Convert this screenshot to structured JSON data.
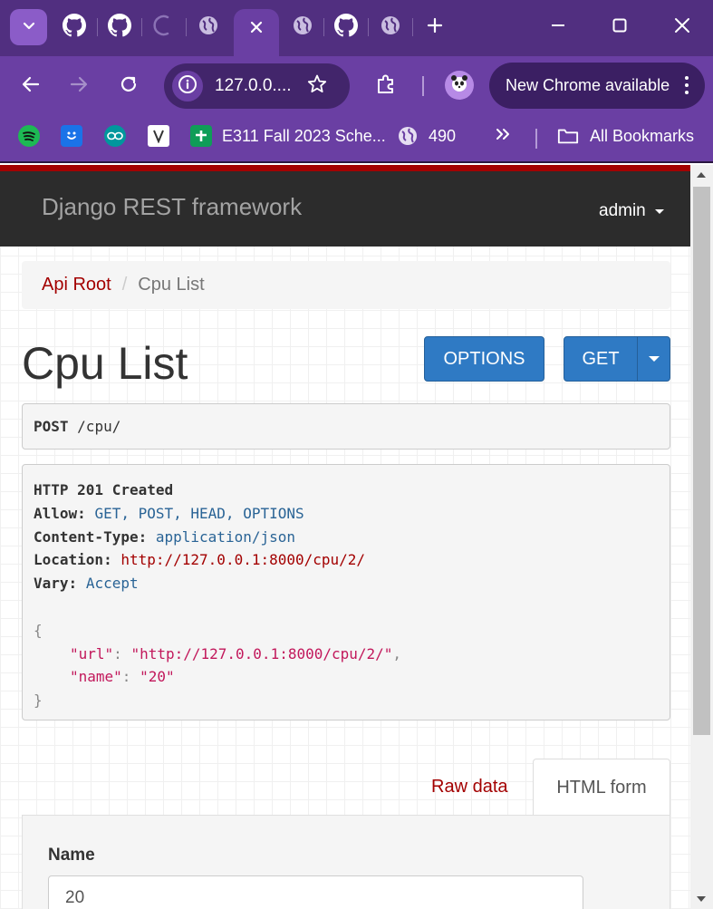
{
  "browser": {
    "tabs": [
      {
        "icon": "github-icon"
      },
      {
        "icon": "github-icon"
      },
      {
        "icon": "loading-spinner-icon"
      },
      {
        "icon": "globe-icon"
      },
      {
        "icon": "close-icon",
        "active": true
      },
      {
        "icon": "globe-icon"
      },
      {
        "icon": "github-icon"
      },
      {
        "icon": "globe-icon"
      }
    ],
    "new_tab_icon": "plus-icon",
    "address": {
      "url_display": "127.0.0...."
    },
    "update_button": "New Chrome available",
    "bookmarks": [
      {
        "icon": "spotify-icon",
        "label": ""
      },
      {
        "icon": "bookmark-app-icon",
        "label": ""
      },
      {
        "icon": "arduino-icon",
        "label": ""
      },
      {
        "icon": "v-logo-icon",
        "label": ""
      },
      {
        "icon": "sheets-icon",
        "label": "E311 Fall 2023 Sche..."
      },
      {
        "icon": "globe-icon",
        "label": "490"
      }
    ],
    "all_bookmarks": "All Bookmarks"
  },
  "colors": {
    "brand_red": "#a30000",
    "button_blue": "#2f7ac4",
    "chrome_purple": "#6a3fa3"
  },
  "navbar": {
    "brand": "Django REST framework",
    "user": "admin"
  },
  "breadcrumb": {
    "root": "Api Root",
    "separator": "/",
    "current": "Cpu List"
  },
  "page": {
    "title": "Cpu List",
    "options_button": "OPTIONS",
    "get_button": "GET"
  },
  "request": {
    "method": "POST",
    "path": "/cpu/"
  },
  "response": {
    "status": "HTTP 201 Created",
    "headers": [
      {
        "key": "Allow:",
        "value": "GET, POST, HEAD, OPTIONS"
      },
      {
        "key": "Content-Type:",
        "value": "application/json"
      },
      {
        "key": "Location:",
        "value": "http://127.0.0.1:8000/cpu/2/"
      },
      {
        "key": "Vary:",
        "value": "Accept"
      }
    ],
    "body": {
      "open": "{",
      "url_key": "\"url\"",
      "url_value": "\"http://127.0.0.1:8000/cpu/2/\"",
      "name_key": "\"name\"",
      "name_value": "\"20\"",
      "close": "}"
    }
  },
  "form": {
    "tab_raw": "Raw data",
    "tab_html": "HTML form",
    "name_label": "Name",
    "name_value": "20"
  }
}
